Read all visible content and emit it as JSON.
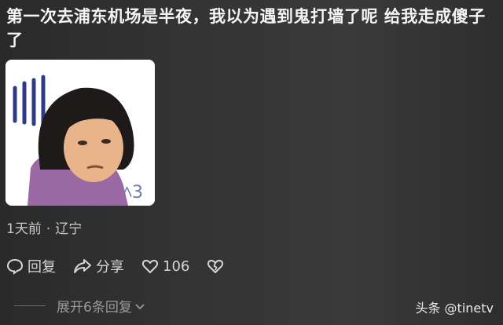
{
  "comment": {
    "text": "第一次去浦东机场是半夜，我以为遇到鬼打墙了呢 给我走成傻子了",
    "time": "1天前",
    "location": "辽宁",
    "separator": "·"
  },
  "sticker": {
    "icon": "frustrated-cartoon-sticker"
  },
  "actions": {
    "reply_label": "回复",
    "share_label": "分享",
    "like_count": "106"
  },
  "replies": {
    "expand_label": "展开6条回复"
  },
  "watermark": {
    "text": "头条 @tinetv"
  }
}
